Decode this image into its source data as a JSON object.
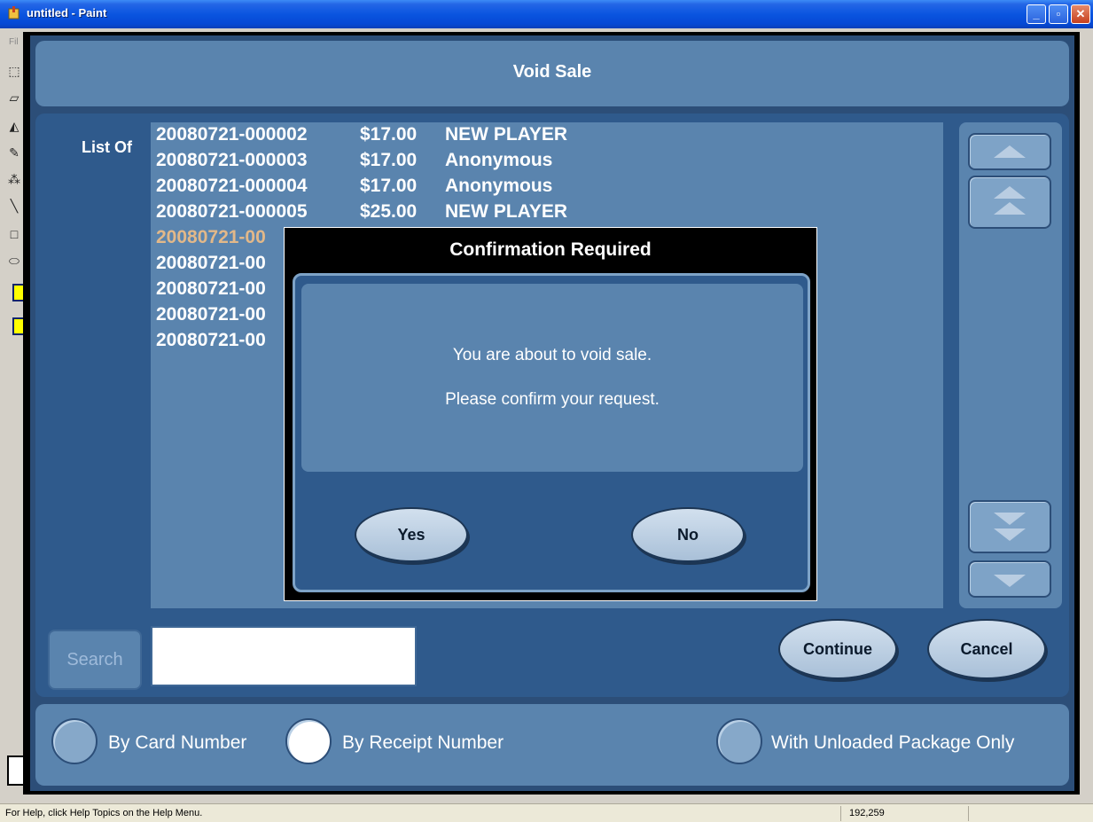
{
  "window": {
    "title": "untitled - Paint",
    "minimize": "_",
    "maximize": "▫",
    "close": "✕"
  },
  "paint": {
    "menu_remnant": "Fil",
    "tools": [
      "select-icon",
      "eraser-icon",
      "fill-icon",
      "pencil-icon",
      "airbrush-icon",
      "line-icon",
      "rectangle-icon",
      "ellipse-icon"
    ]
  },
  "app": {
    "header_title": "Void Sale",
    "list_label": "List Of",
    "rows": [
      {
        "id": "20080721-000002",
        "amount": "$17.00",
        "name": "NEW PLAYER"
      },
      {
        "id": "20080721-000003",
        "amount": "$17.00",
        "name": "Anonymous"
      },
      {
        "id": "20080721-000004",
        "amount": "$17.00",
        "name": "Anonymous"
      },
      {
        "id": "20080721-000005",
        "amount": "$25.00",
        "name": "NEW PLAYER"
      },
      {
        "id": "20080721-00",
        "amount": "",
        "name": ""
      },
      {
        "id": "20080721-00",
        "amount": "",
        "name": ""
      },
      {
        "id": "20080721-00",
        "amount": "",
        "name": ""
      },
      {
        "id": "20080721-00",
        "amount": "",
        "name": ""
      },
      {
        "id": "20080721-00",
        "amount": "",
        "name": ""
      }
    ],
    "search_label": "Search",
    "search_value": "",
    "continue_label": "Continue",
    "cancel_label": "Cancel",
    "radio_card": "By Card Number",
    "radio_receipt": "By Receipt Number",
    "radio_unloaded": "With Unloaded Package Only",
    "selected_radio": "By Receipt Number"
  },
  "dialog": {
    "title": "Confirmation Required",
    "line1": "You are about to void sale.",
    "line2": "Please confirm your request.",
    "yes_label": "Yes",
    "no_label": "No"
  },
  "statusbar": {
    "help": "For Help, click Help Topics on the Help Menu.",
    "coords": "192,259"
  },
  "colors": {
    "titlebar": "#0a55e0",
    "app_background": "#2c4e78",
    "panel": "#5a84ae",
    "selected_row_text": "#e2b889"
  }
}
